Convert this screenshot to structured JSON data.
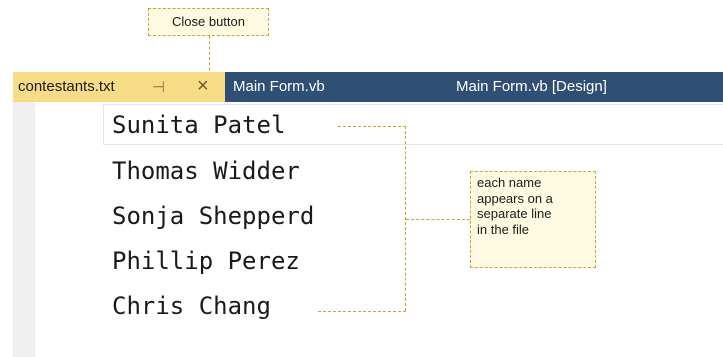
{
  "callouts": {
    "close_button": "Close button",
    "lines": [
      "each name",
      "appears on a",
      "separate line",
      "in the file"
    ]
  },
  "tabs": {
    "active": {
      "label": "contestants.txt",
      "pin_icon": "pin-icon",
      "close_icon": "close-icon"
    },
    "others": [
      "Main Form.vb",
      "Main Form.vb [Design]"
    ]
  },
  "editor": {
    "lines": [
      "Sunita Patel",
      "Thomas Widder",
      "Sonja Shepperd",
      "Phillip Perez",
      "Chris Chang"
    ]
  },
  "colors": {
    "tab_bar": "#2f4f75",
    "active_tab": "#f6dc86",
    "callout_border": "#c8a23a",
    "callout_fill": "#fffbe3"
  }
}
